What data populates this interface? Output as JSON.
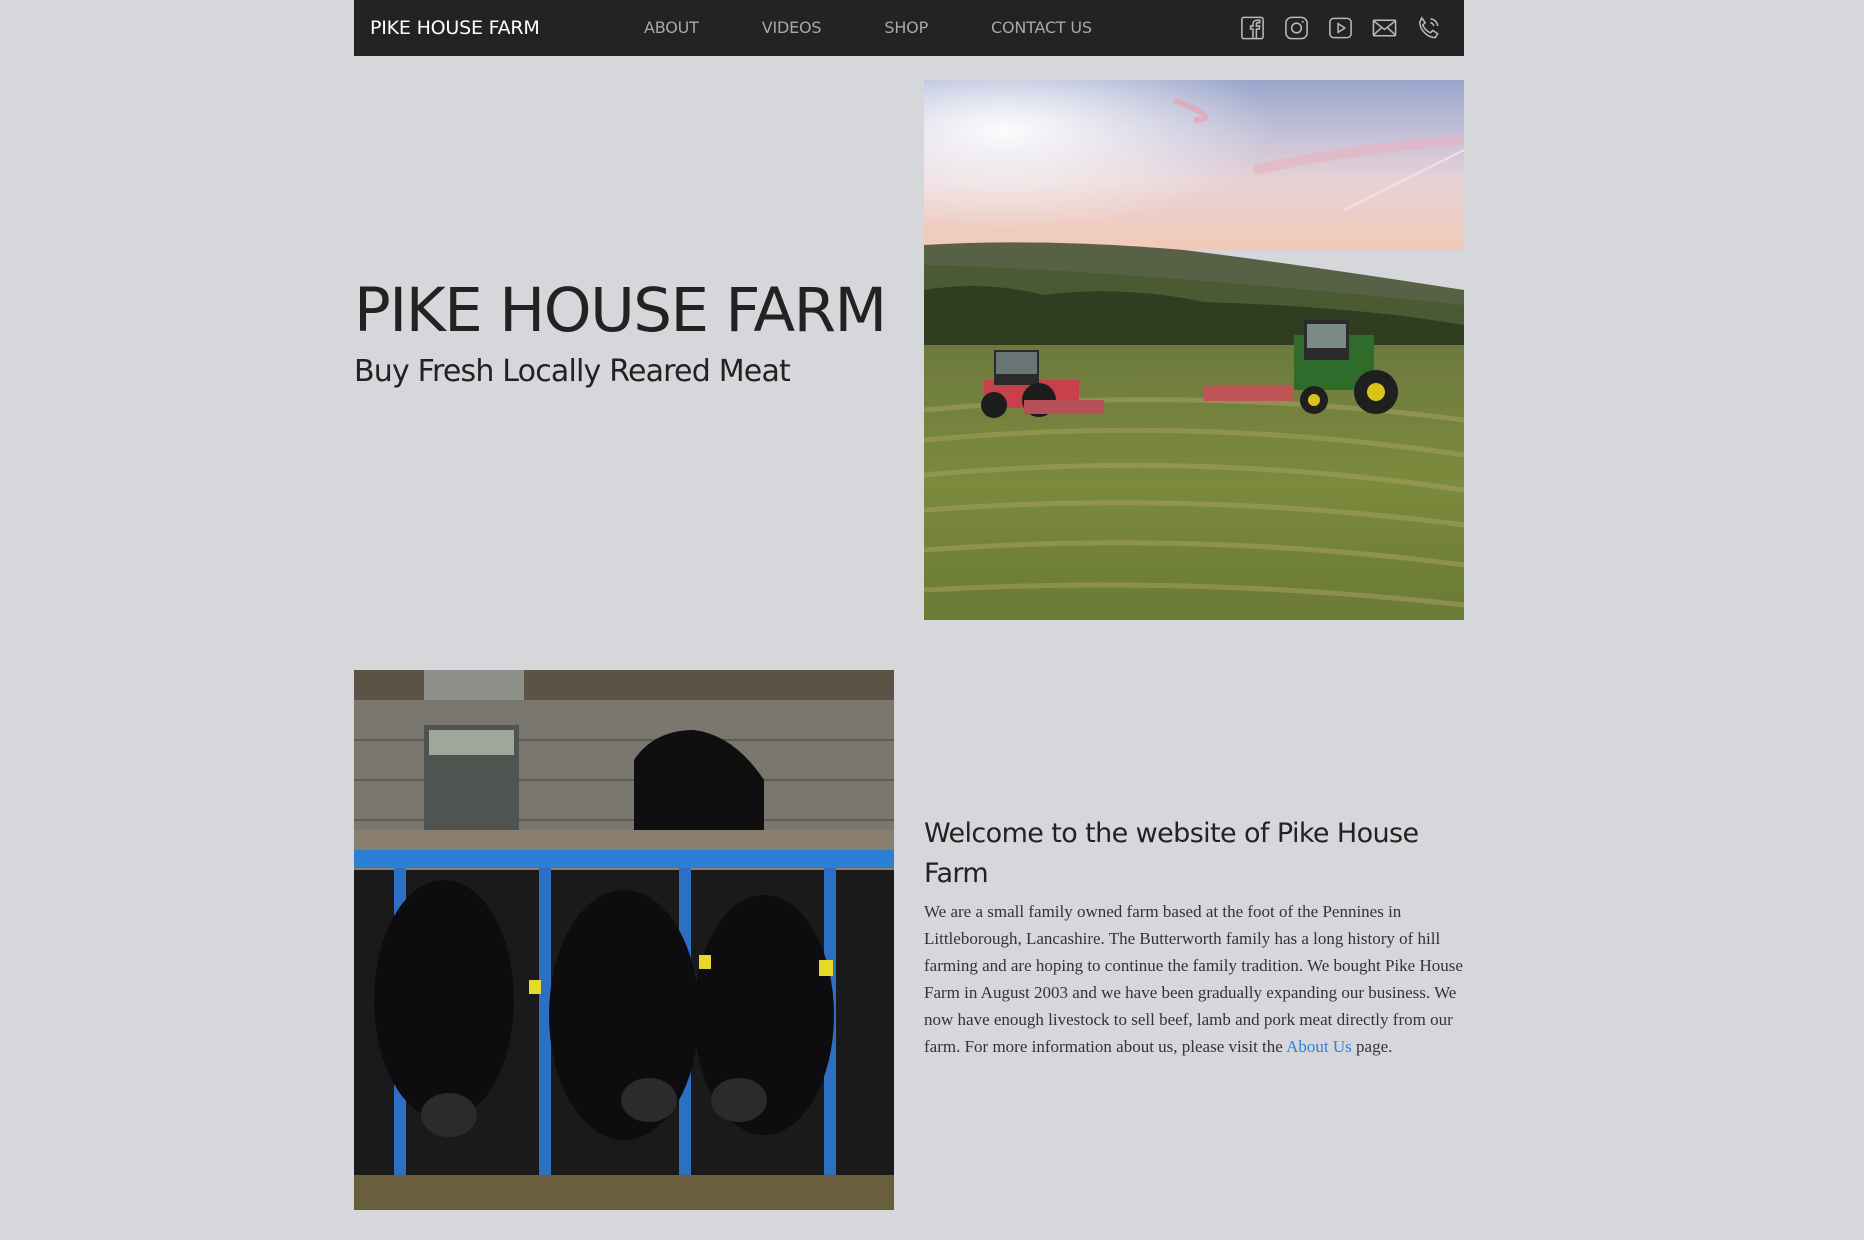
{
  "nav": {
    "brand": "PIKE HOUSE FARM",
    "links": [
      "ABOUT",
      "VIDEOS",
      "SHOP",
      "CONTACT US"
    ],
    "icons": [
      "facebook-icon",
      "instagram-icon",
      "youtube-icon",
      "email-icon",
      "phone-icon"
    ]
  },
  "hero": {
    "title": "PIKE HOUSE FARM",
    "subtitle": "Buy Fresh Locally Reared Meat"
  },
  "welcome": {
    "title": "Welcome to the website of Pike House Farm",
    "body": "We are a small family owned farm based at the foot of the Pennines in Littleborough, Lancashire. The Butterworth family has a long history of hill farming and are hoping to continue the family tradition. We bought Pike House Farm in August 2003 and we have been gradually expanding our business. We now have enough livestock to sell beef, lamb and pork meat directly from our farm. For more information about us, please visit the",
    "link_text": "About Us",
    "body_end": "page."
  },
  "colors": {
    "background": "#d6d7da",
    "navbar": "#232323",
    "link": "#2f7fe0"
  }
}
